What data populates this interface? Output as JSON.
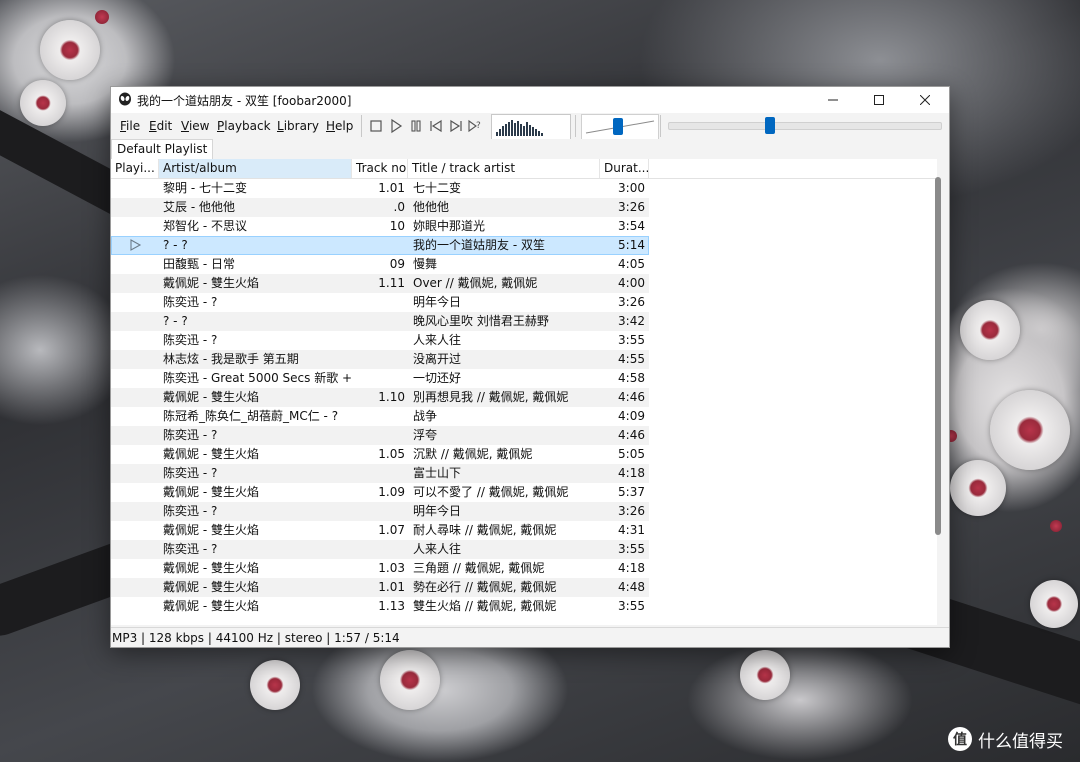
{
  "window": {
    "title": "我的一个道姑朋友 - 双笙  [foobar2000]"
  },
  "menu": {
    "items": [
      {
        "label": "File",
        "key": "F"
      },
      {
        "label": "Edit",
        "key": "E"
      },
      {
        "label": "View",
        "key": "V"
      },
      {
        "label": "Playback",
        "key": "P"
      },
      {
        "label": "Library",
        "key": "L"
      },
      {
        "label": "Help",
        "key": "H"
      }
    ]
  },
  "toolbar": {
    "buttons": [
      "stop-icon",
      "play-icon",
      "pause-icon",
      "previous-icon",
      "next-icon",
      "random-icon"
    ],
    "volume_level": 0.47,
    "seek_level": 0.37
  },
  "playlist_tab": {
    "label": "Default Playlist"
  },
  "columns": {
    "playing": "Playi...",
    "artist": "Artist/album",
    "track": "Track no",
    "title": "Title / track artist",
    "duration": "Durat..."
  },
  "tracks": [
    {
      "artist": "黎明 - 七十二变",
      "track": "1.01",
      "title": "七十二变",
      "duration": "3:00",
      "playing": false
    },
    {
      "artist": "艾辰 - 他他他",
      "track": ".0",
      "title": "他他他",
      "duration": "3:26",
      "playing": false
    },
    {
      "artist": "郑智化 - 不思议",
      "track": "10",
      "title": "妳眼中那道光",
      "duration": "3:54",
      "playing": false
    },
    {
      "artist": "? - ?",
      "track": "",
      "title": "我的一个道姑朋友 - 双笙",
      "duration": "5:14",
      "playing": true
    },
    {
      "artist": "田馥甄 - 日常",
      "track": "09",
      "title": "慢舞",
      "duration": "4:05",
      "playing": false
    },
    {
      "artist": "戴佩妮 - 雙生火焰",
      "track": "1.11",
      "title": "Over // 戴佩妮, 戴佩妮",
      "duration": "4:00",
      "playing": false
    },
    {
      "artist": "陈奕迅 - ?",
      "track": "",
      "title": "明年今日",
      "duration": "3:26",
      "playing": false
    },
    {
      "artist": "? - ?",
      "track": "",
      "title": "晚风心里吹 刘惜君王赫野",
      "duration": "3:42",
      "playing": false
    },
    {
      "artist": "陈奕迅 - ?",
      "track": "",
      "title": "人来人往",
      "duration": "3:55",
      "playing": false
    },
    {
      "artist": "林志炫 - 我是歌手 第五期",
      "track": "",
      "title": "没离开过",
      "duration": "4:55",
      "playing": false
    },
    {
      "artist": "陈奕迅 - Great 5000 Secs 新歌 + ...",
      "track": "",
      "title": "一切还好",
      "duration": "4:58",
      "playing": false
    },
    {
      "artist": "戴佩妮 - 雙生火焰",
      "track": "1.10",
      "title": "別再想見我 // 戴佩妮, 戴佩妮",
      "duration": "4:46",
      "playing": false
    },
    {
      "artist": "陈冠希_陈奂仁_胡蓓蔚_MC仁 - ?",
      "track": "",
      "title": "战争",
      "duration": "4:09",
      "playing": false
    },
    {
      "artist": "陈奕迅 - ?",
      "track": "",
      "title": "浮夸",
      "duration": "4:46",
      "playing": false
    },
    {
      "artist": "戴佩妮 - 雙生火焰",
      "track": "1.05",
      "title": "沉默 // 戴佩妮, 戴佩妮",
      "duration": "5:05",
      "playing": false
    },
    {
      "artist": "陈奕迅 - ?",
      "track": "",
      "title": "富士山下",
      "duration": "4:18",
      "playing": false
    },
    {
      "artist": "戴佩妮 - 雙生火焰",
      "track": "1.09",
      "title": "可以不愛了 // 戴佩妮, 戴佩妮",
      "duration": "5:37",
      "playing": false
    },
    {
      "artist": "陈奕迅 - ?",
      "track": "",
      "title": "明年今日",
      "duration": "3:26",
      "playing": false
    },
    {
      "artist": "戴佩妮 - 雙生火焰",
      "track": "1.07",
      "title": "耐人尋味 // 戴佩妮, 戴佩妮",
      "duration": "4:31",
      "playing": false
    },
    {
      "artist": "陈奕迅 - ?",
      "track": "",
      "title": "人来人往",
      "duration": "3:55",
      "playing": false
    },
    {
      "artist": "戴佩妮 - 雙生火焰",
      "track": "1.03",
      "title": "三角題 // 戴佩妮, 戴佩妮",
      "duration": "4:18",
      "playing": false
    },
    {
      "artist": "戴佩妮 - 雙生火焰",
      "track": "1.01",
      "title": "勢在必行 // 戴佩妮, 戴佩妮",
      "duration": "4:48",
      "playing": false
    },
    {
      "artist": "戴佩妮 - 雙生火焰",
      "track": "1.13",
      "title": "雙生火焰 // 戴佩妮, 戴佩妮",
      "duration": "3:55",
      "playing": false
    }
  ],
  "status": {
    "text": "MP3 | 128 kbps | 44100 Hz | stereo | 1:57 / 5:14"
  },
  "watermark": {
    "logo": "值",
    "text": "什么值得买"
  },
  "colors": {
    "selection": "#cce8ff",
    "accent": "#0067c0",
    "header_sorted": "#d9ebf9"
  }
}
